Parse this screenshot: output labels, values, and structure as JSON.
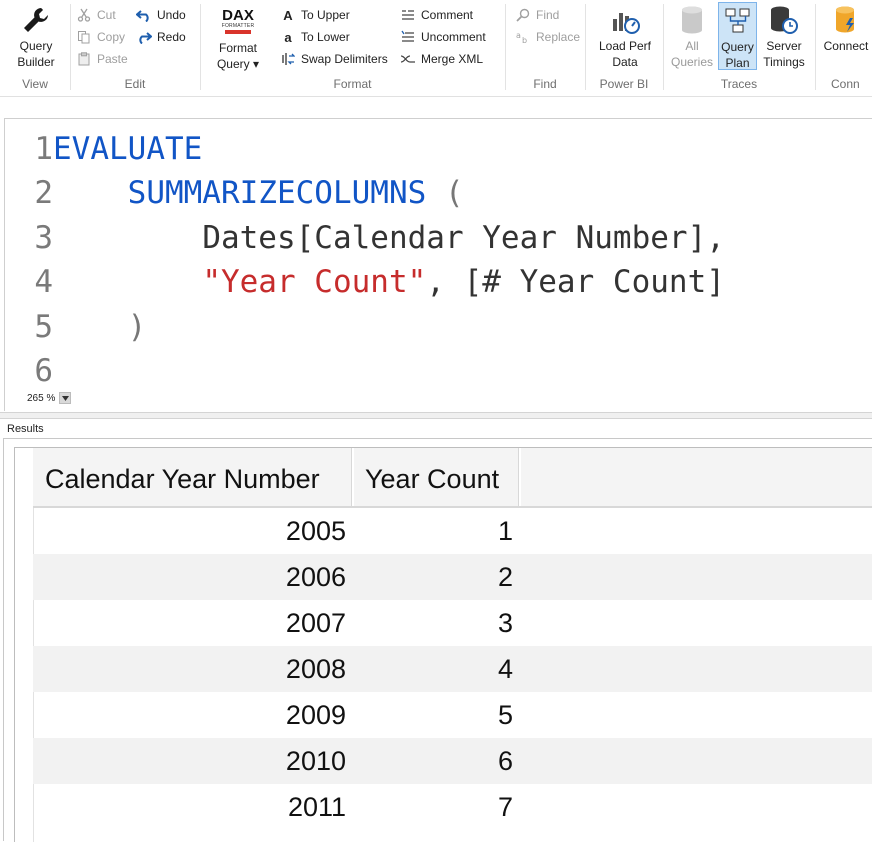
{
  "ribbon": {
    "view": {
      "group_label": "View",
      "query_builder": "Query\nBuilder"
    },
    "edit": {
      "group_label": "Edit",
      "cut": "Cut",
      "copy": "Copy",
      "paste": "Paste",
      "undo": "Undo",
      "redo": "Redo"
    },
    "format": {
      "group_label": "Format",
      "dax_logo": "DAX",
      "dax_logo_sub": "FORMATTER",
      "format_query": "Format\nQuery ▾",
      "to_upper": "To Upper",
      "to_lower": "To Lower",
      "swap_delimiters": "Swap Delimiters",
      "comment": "Comment",
      "uncomment": "Uncomment",
      "merge_xml": "Merge XML"
    },
    "find": {
      "group_label": "Find",
      "find": "Find",
      "replace": "Replace"
    },
    "powerbi": {
      "group_label": "Power BI",
      "load_perf_data": "Load Perf\nData"
    },
    "traces": {
      "group_label": "Traces",
      "all_queries": "All\nQueries",
      "query_plan": "Query\nPlan",
      "server_timings": "Server\nTimings"
    },
    "connection": {
      "group_label": "Conn",
      "connect": "Connect"
    }
  },
  "editor": {
    "line_numbers": [
      "1",
      "2",
      "3",
      "4",
      "5",
      "6"
    ],
    "line1": {
      "kw": "EVALUATE"
    },
    "line2": {
      "kw": "SUMMARIZECOLUMNS",
      "paren": " ("
    },
    "line3": {
      "text": "Dates[Calendar Year Number],"
    },
    "line4": {
      "str": "\"Year Count\"",
      "text": ", [# Year Count]"
    },
    "line5": {
      "paren": ")"
    },
    "zoom": "265 %"
  },
  "results": {
    "label": "Results",
    "columns": [
      "Calendar Year Number",
      "Year Count"
    ],
    "rows": [
      [
        "2005",
        "1"
      ],
      [
        "2006",
        "2"
      ],
      [
        "2007",
        "3"
      ],
      [
        "2008",
        "4"
      ],
      [
        "2009",
        "5"
      ],
      [
        "2010",
        "6"
      ],
      [
        "2011",
        "7"
      ]
    ]
  },
  "colors": {
    "keyword": "#1155c6",
    "string": "#c62c2c",
    "active_button_bg": "#cde4f7"
  }
}
